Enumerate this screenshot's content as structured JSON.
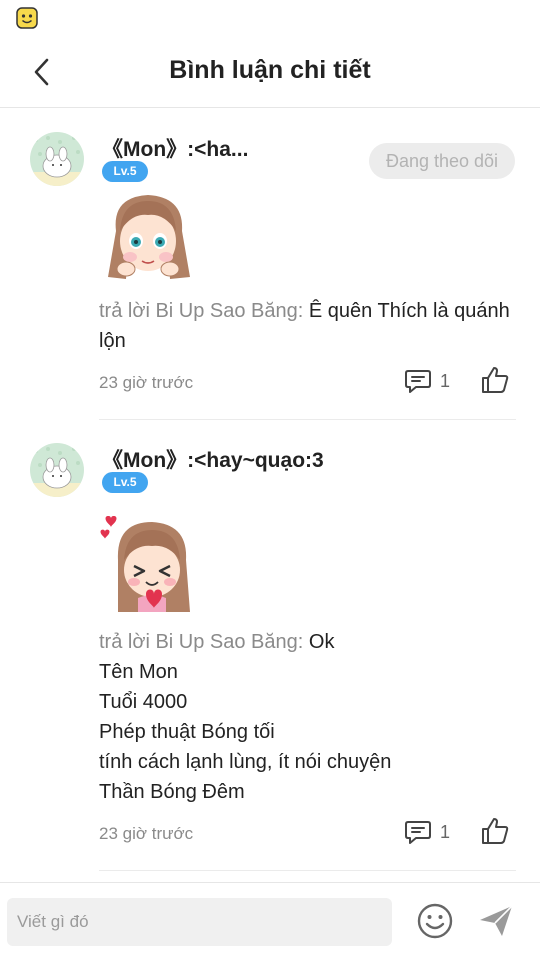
{
  "header": {
    "title": "Bình luận chi tiết"
  },
  "comments": [
    {
      "username": "《Mon》:<ha...",
      "level": "Lv.5",
      "follow_label": "Đang theo dõi",
      "reply_prefix": "trả lời Bi Up Sao Băng:",
      "text_lines": [
        "Ê quên Thích là quánh lộn"
      ],
      "time": "23 giờ trước",
      "reply_count": "1"
    },
    {
      "username": "《Mon》:<hay~quạo:3",
      "level": "Lv.5",
      "reply_prefix": "trả lời Bi Up Sao Băng:",
      "text_lines": [
        "Ok",
        "Tên Mon",
        "Tuổi 4000",
        "Phép thuật Bóng tối",
        "tính cách lạnh lùng, ít nói chuyện",
        "Thần Bóng Đêm"
      ],
      "time": "23 giờ trước",
      "reply_count": "1"
    }
  ],
  "composer": {
    "placeholder": "Viết gì đó"
  },
  "colors": {
    "level_badge": "#42a5f0",
    "follow_bg": "#ececec",
    "follow_text": "#b3b3b3",
    "muted_text": "#8a8a8a"
  },
  "icons": {
    "status": "app-face-icon",
    "back": "chevron-left-icon",
    "reply": "comment-bubble-icon",
    "like": "thumbs-up-icon",
    "emoji": "smiley-icon",
    "send": "paper-plane-icon"
  }
}
